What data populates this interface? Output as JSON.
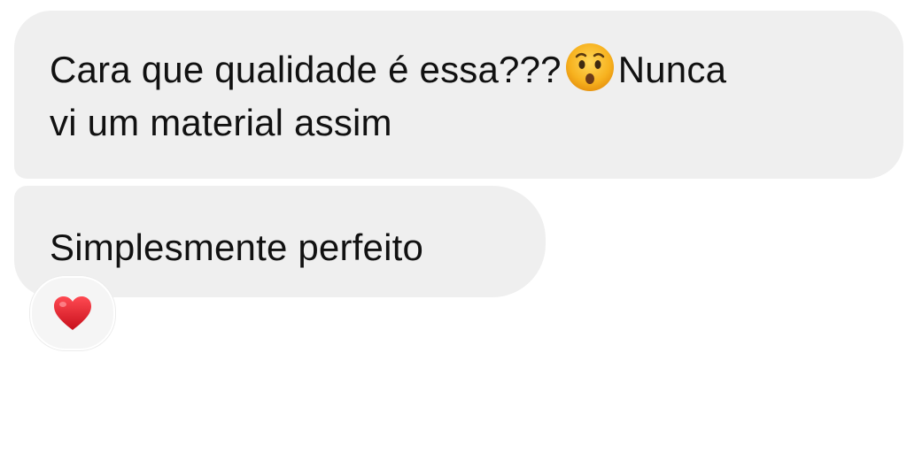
{
  "messages": [
    {
      "line1_before": "Cara que qualidade é essa???",
      "emoji": "hushed-face",
      "line1_after": "Nunca",
      "line2": "vi um material assim"
    },
    {
      "text": "Simplesmente perfeito"
    }
  ],
  "reaction": {
    "icon": "red-heart"
  },
  "colors": {
    "bubble": "#efefef",
    "text": "#111111",
    "heart": "#e0202a"
  }
}
